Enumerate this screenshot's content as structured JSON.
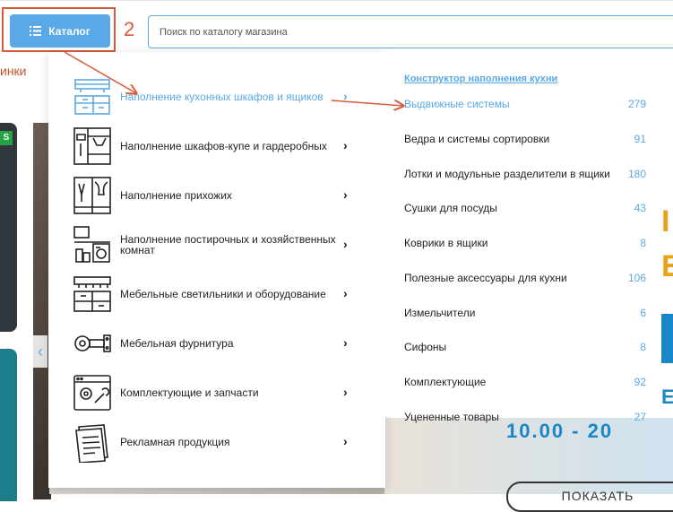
{
  "header": {
    "catalog_label": "Каталог",
    "step_number": "2",
    "search_placeholder": "Поиск по каталогу магазина",
    "left_crumb": "инки"
  },
  "background": {
    "left_badge": "S",
    "right_letters": [
      "I",
      "E",
      "",
      "E"
    ],
    "bottom_text": "10.00 - 20",
    "bottom_button": "ПОКАЗАТЬ",
    "arrow": "‹"
  },
  "menu": {
    "items": [
      {
        "label": "Наполнение кухонных шкафов и ящиков",
        "icon": "kitchen-cabinet-icon",
        "active": true
      },
      {
        "label": "Наполнение шкафов-купе и гардеробных",
        "icon": "wardrobe-icon",
        "active": false
      },
      {
        "label": "Наполнение прихожих",
        "icon": "hallway-icon",
        "active": false
      },
      {
        "label": "Наполнение постирочных и хозяйственных комнат",
        "icon": "laundry-icon",
        "active": false
      },
      {
        "label": "Мебельные светильники и оборудование",
        "icon": "furniture-light-icon",
        "active": false
      },
      {
        "label": "Мебельная фурнитура",
        "icon": "hinge-icon",
        "active": false
      },
      {
        "label": "Комплектующие и запчасти",
        "icon": "tools-icon",
        "active": false
      },
      {
        "label": "Рекламная продукция",
        "icon": "catalog-brochure-icon",
        "active": false
      }
    ],
    "chevron": "›"
  },
  "submenu": {
    "heading": "Конструктор наполнения кухни",
    "rows": [
      {
        "name": "Выдвижные системы",
        "count": "279",
        "active": true
      },
      {
        "name": "Ведра и системы сортировки",
        "count": "91",
        "active": false
      },
      {
        "name": "Лотки и модульные разделители в ящики",
        "count": "180",
        "active": false
      },
      {
        "name": "Сушки для посуды",
        "count": "43",
        "active": false
      },
      {
        "name": "Коврики в ящики",
        "count": "8",
        "active": false
      },
      {
        "name": "Полезные аксессуары для кухни",
        "count": "106",
        "active": false
      },
      {
        "name": "Измельчители",
        "count": "6",
        "active": false
      },
      {
        "name": "Сифоны",
        "count": "8",
        "active": false
      },
      {
        "name": "Комплектующие",
        "count": "92",
        "active": false
      },
      {
        "name": "Уцененные товары",
        "count": "27",
        "active": false
      }
    ]
  },
  "colors": {
    "accent": "#5aa9e6",
    "annotation": "#d9593a"
  }
}
